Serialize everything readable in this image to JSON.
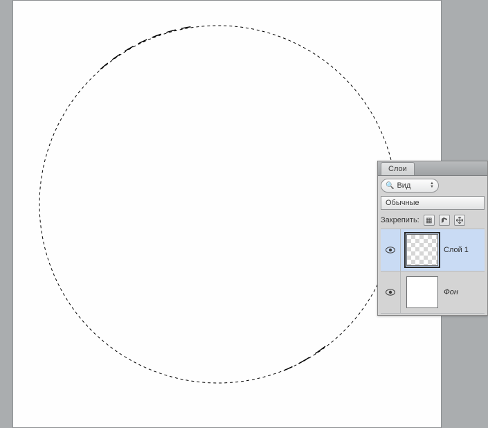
{
  "panel": {
    "tab_label": "Слои",
    "filter_label": "Вид",
    "blend_mode": "Обычные",
    "lock_label": "Закрепить:"
  },
  "layers": [
    {
      "name": "Слой 1",
      "visible": true,
      "selected": true,
      "transparent": true
    },
    {
      "name": "Фон",
      "visible": true,
      "selected": false,
      "transparent": false
    }
  ]
}
